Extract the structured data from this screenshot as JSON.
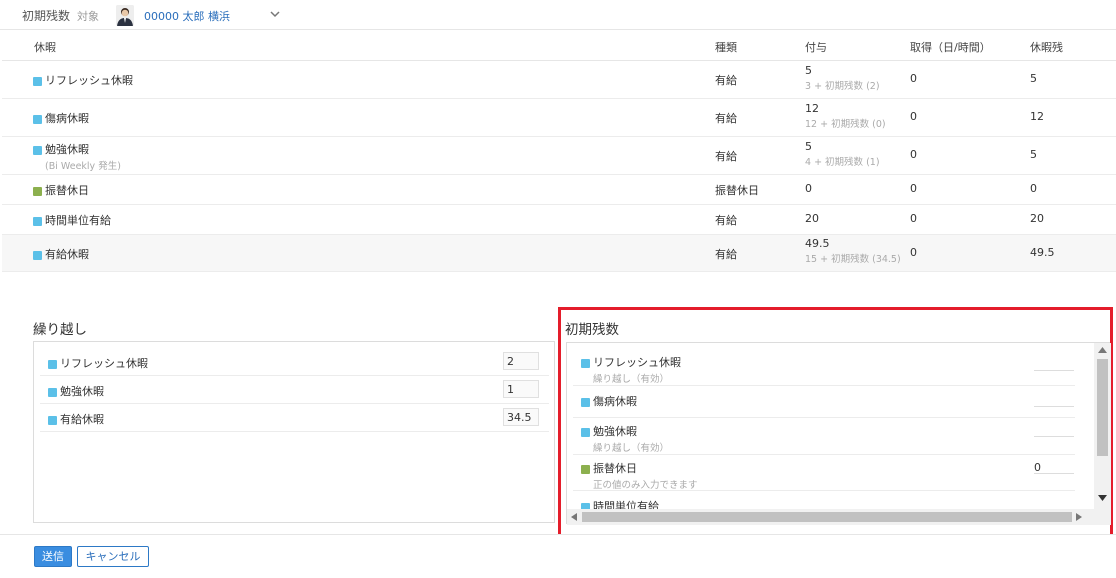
{
  "colors": {
    "paid_leave": "#5bc0e8",
    "substitute_holiday": "#8cb04e",
    "highlight_frame": "#e41d2b",
    "primary_button": "#3a8de0",
    "link": "#2a6ebb"
  },
  "header": {
    "title": "初期残数",
    "target_label": "対象",
    "person": "00000 太郎 横浜",
    "avatar_icon": "person-avatar",
    "dropdown_icon": "chevron-down-icon"
  },
  "table": {
    "columns": {
      "leave": "休暇",
      "type": "種類",
      "granted": "付与",
      "taken": "取得（日/時間）",
      "remaining": "休暇残"
    },
    "rows": [
      {
        "name": "リフレッシュ休暇",
        "note": "",
        "type": "有給",
        "granted": "5",
        "granted_sub": "3 + 初期残数 (2)",
        "taken": "0",
        "remaining": "5",
        "color": "#5bc0e8"
      },
      {
        "name": "傷病休暇",
        "note": "",
        "type": "有給",
        "granted": "12",
        "granted_sub": "12 + 初期残数 (0)",
        "taken": "0",
        "remaining": "12",
        "color": "#5bc0e8"
      },
      {
        "name": "勉強休暇",
        "note": "(Bi Weekly 発生)",
        "type": "有給",
        "granted": "5",
        "granted_sub": "4 + 初期残数 (1)",
        "taken": "0",
        "remaining": "5",
        "color": "#5bc0e8"
      },
      {
        "name": "振替休日",
        "note": "",
        "type": "振替休日",
        "granted": "0",
        "granted_sub": "",
        "taken": "0",
        "remaining": "0",
        "color": "#8cb04e"
      },
      {
        "name": "時間単位有給",
        "note": "",
        "type": "有給",
        "granted": "20",
        "granted_sub": "",
        "taken": "0",
        "remaining": "20",
        "color": "#5bc0e8"
      },
      {
        "name": "有給休暇",
        "note": "",
        "type": "有給",
        "granted": "49.5",
        "granted_sub": "15 + 初期残数 (34.5)",
        "taken": "0",
        "remaining": "49.5",
        "color": "#5bc0e8"
      }
    ]
  },
  "carry_forward": {
    "title": "繰り越し",
    "items": [
      {
        "name": "リフレッシュ休暇",
        "value": "2"
      },
      {
        "name": "勉強休暇",
        "value": "1"
      },
      {
        "name": "有給休暇",
        "value": "34.5"
      }
    ]
  },
  "initial_balance": {
    "title": "初期残数",
    "items": [
      {
        "name": "リフレッシュ休暇",
        "sub": "繰り越し（有効）",
        "value": "",
        "color": "#5bc0e8"
      },
      {
        "name": "傷病休暇",
        "sub": "",
        "value": "",
        "color": "#5bc0e8"
      },
      {
        "name": "勉強休暇",
        "sub": "繰り越し（有効）",
        "value": "",
        "color": "#5bc0e8"
      },
      {
        "name": "振替休日",
        "sub": "正の値のみ入力できます",
        "value": "0",
        "color": "#8cb04e"
      },
      {
        "name": "時間単位有給",
        "sub": "",
        "value": "",
        "color": "#5bc0e8"
      }
    ]
  },
  "footer": {
    "submit": "送信",
    "cancel": "キャンセル"
  }
}
